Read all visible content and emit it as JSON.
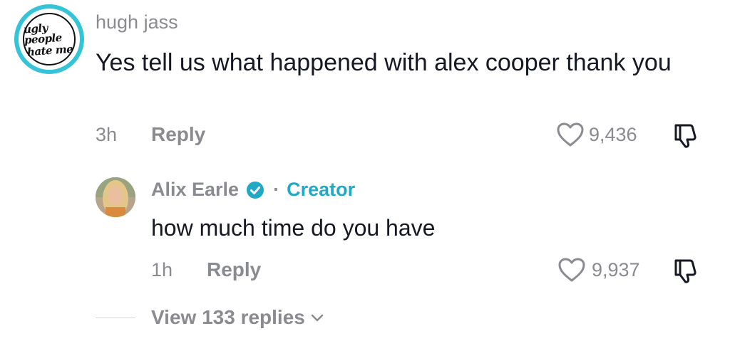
{
  "comment": {
    "avatar_text_line1": "ugly people",
    "avatar_text_line2": "hate me",
    "username": "hugh jass",
    "text": "Yes tell us what happened with alex cooper thank you",
    "time": "3h",
    "reply_label": "Reply",
    "like_count": "9,436"
  },
  "reply": {
    "username": "Alix Earle",
    "separator": "·",
    "role_badge": "Creator",
    "text": "how much time do you have",
    "time": "1h",
    "reply_label": "Reply",
    "like_count": "9,937"
  },
  "view_replies": {
    "label": "View 133 replies"
  },
  "colors": {
    "text_primary": "#161823",
    "text_secondary": "#8a8b91",
    "creator_accent": "#20a9c4",
    "avatar_ring": "#35c3d8",
    "verified_badge": "#20a9c4"
  },
  "icons": [
    "heart-outline-icon",
    "dislike-thumb-icon",
    "verified-check-icon",
    "chevron-down-icon"
  ]
}
